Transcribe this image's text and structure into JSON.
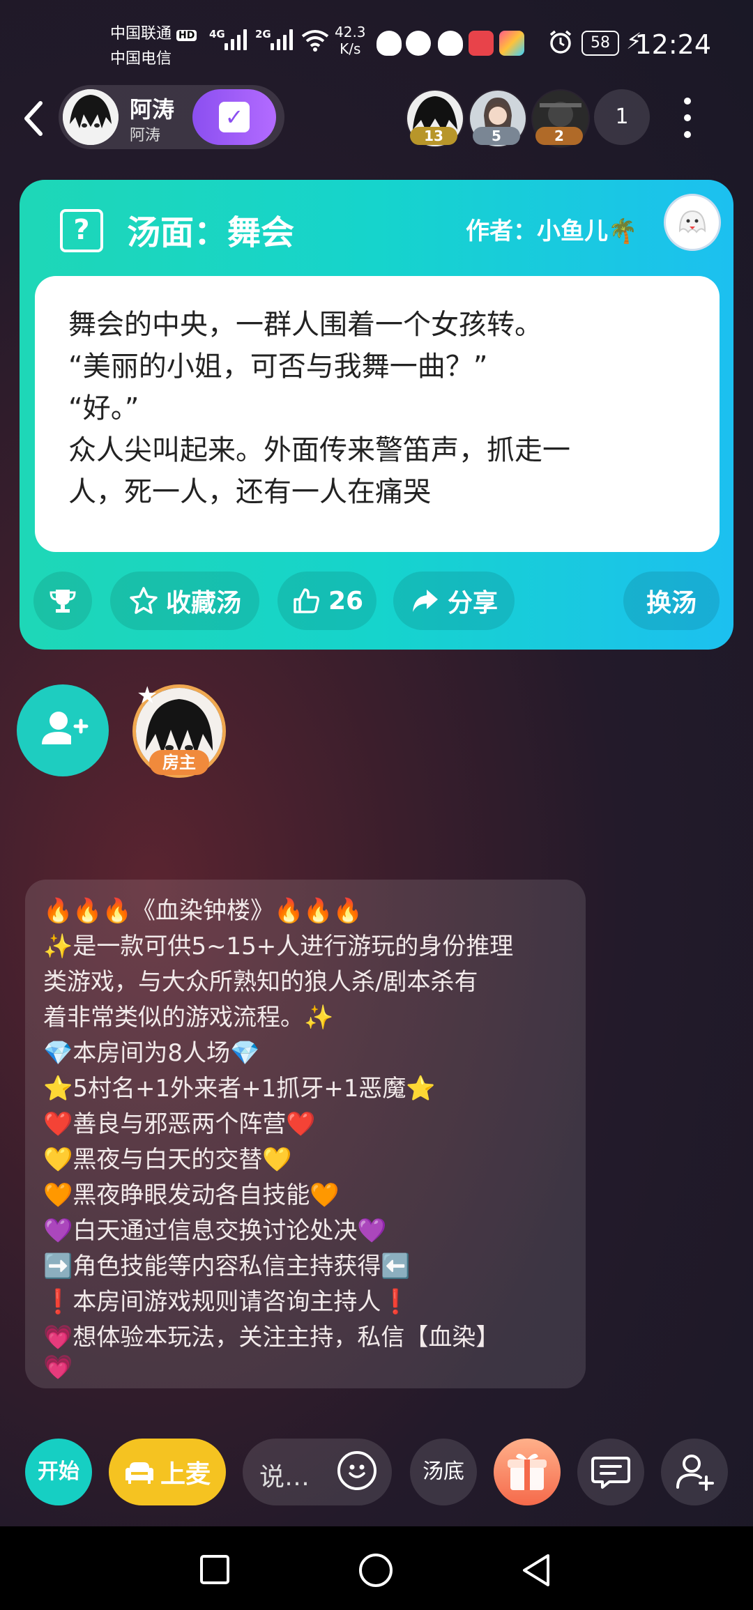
{
  "status_bar": {
    "carrier_1": "中国联通",
    "hd_badge": "HD",
    "carrier_2": "中国电信",
    "net_4g": "4G",
    "net_2g": "2G",
    "speed_value": "42.3",
    "speed_unit": "K/s",
    "alarm_icon": "alarm-icon",
    "battery": "58",
    "time": "12:24"
  },
  "header": {
    "host_name": "阿涛",
    "host_subtitle": "阿涛",
    "members": [
      {
        "badge": "13",
        "badge_color": "#b8962a"
      },
      {
        "badge": "5",
        "badge_color": "#7a8694"
      },
      {
        "badge": "2",
        "badge_color": "#b06a28"
      }
    ],
    "online_count": "1"
  },
  "soup": {
    "icon_label": "?",
    "title": "汤面：舞会",
    "author": "作者：小鱼儿🌴",
    "text": "舞会的中央，一群人围着一个女孩转。\n“美丽的小姐，可否与我舞一曲？”\n“好。”\n众人尖叫起来。外面传来警笛声，抓走一\n人，死一人，还有一人在痛哭",
    "collect_label": "收藏汤",
    "like_count": "26",
    "share_label": "分享",
    "change_label": "换汤"
  },
  "seats": {
    "owner_tag": "房主"
  },
  "announcement": {
    "lines": [
      "🔥🔥🔥《血染钟楼》🔥🔥🔥",
      "✨是一款可供5~15+人进行游玩的身份推理",
      "类游戏，与大众所熟知的狼人杀/剧本杀有",
      "着非常类似的游戏流程。✨",
      "💎本房间为8人场💎",
      "⭐5村名+1外来者+1抓牙+1恶魔⭐",
      "❤️善良与邪恶两个阵营❤️",
      "💛黑夜与白天的交替💛",
      "🧡黑夜睁眼发动各自技能🧡",
      "💜白天通过信息交换讨论处决💜",
      "➡️角色技能等内容私信主持获得⬅️",
      "❗本房间游戏规则请咨询主持人❗",
      "💗想体验本玩法，关注主持，私信【血染】",
      "💗"
    ]
  },
  "bottom_bar": {
    "start_label": "开始",
    "mic_label": "上麦",
    "say_placeholder": "说…",
    "answer_label": "汤底"
  },
  "colors": {
    "soup_gradient_start": "#1ed7b7",
    "soup_gradient_end": "#1cc0f0",
    "checkin_purple": "#8b4ff0",
    "mic_yellow": "#f5c321",
    "start_teal": "#16cfc3"
  }
}
